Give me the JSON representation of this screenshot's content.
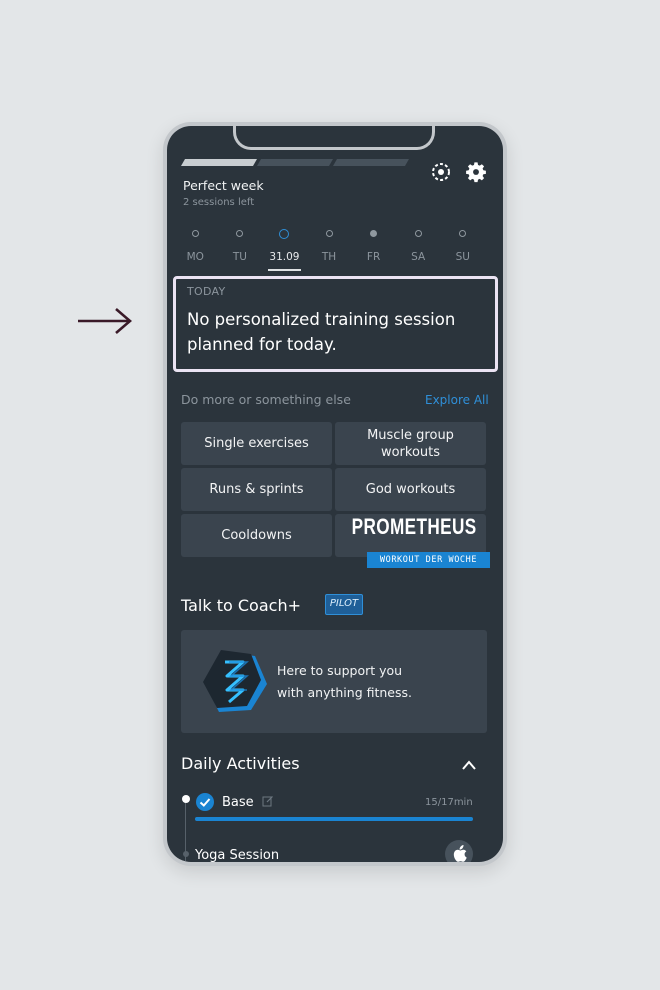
{
  "progress": {
    "segments_total": 3,
    "segments_done": 1
  },
  "header": {
    "title": "Perfect week",
    "subtitle": "2 sessions left"
  },
  "days": [
    {
      "label": "MO",
      "state": "empty"
    },
    {
      "label": "TU",
      "state": "empty"
    },
    {
      "label": "31.09",
      "state": "today"
    },
    {
      "label": "TH",
      "state": "empty"
    },
    {
      "label": "FR",
      "state": "filled"
    },
    {
      "label": "SA",
      "state": "empty"
    },
    {
      "label": "SU",
      "state": "empty"
    }
  ],
  "today": {
    "label": "TODAY",
    "message": "No personalized training session planned for today."
  },
  "more": {
    "label": "Do more or something else",
    "explore": "Explore All"
  },
  "tiles": {
    "single": "Single exercises",
    "muscle": "Muscle group workouts",
    "runs": "Runs & sprints",
    "god": "God workouts",
    "cooldowns": "Cooldowns",
    "prometheus_title": "PROMETHEUS",
    "prometheus_badge": "WORKOUT DER WOCHE"
  },
  "coach": {
    "title": "Talk to Coach+",
    "badge": "PILOT",
    "line1": "Here to support you",
    "line2": "with anything fitness."
  },
  "daily": {
    "title": "Daily Activities",
    "items": [
      {
        "label": "Base",
        "time": "15/17min",
        "progress": 1.0
      },
      {
        "label": "Yoga Session"
      }
    ]
  },
  "colors": {
    "accent": "#1a84d2",
    "background": "#2b343c",
    "tile": "#3a444e",
    "highlight_border": "#ebe3f3"
  }
}
